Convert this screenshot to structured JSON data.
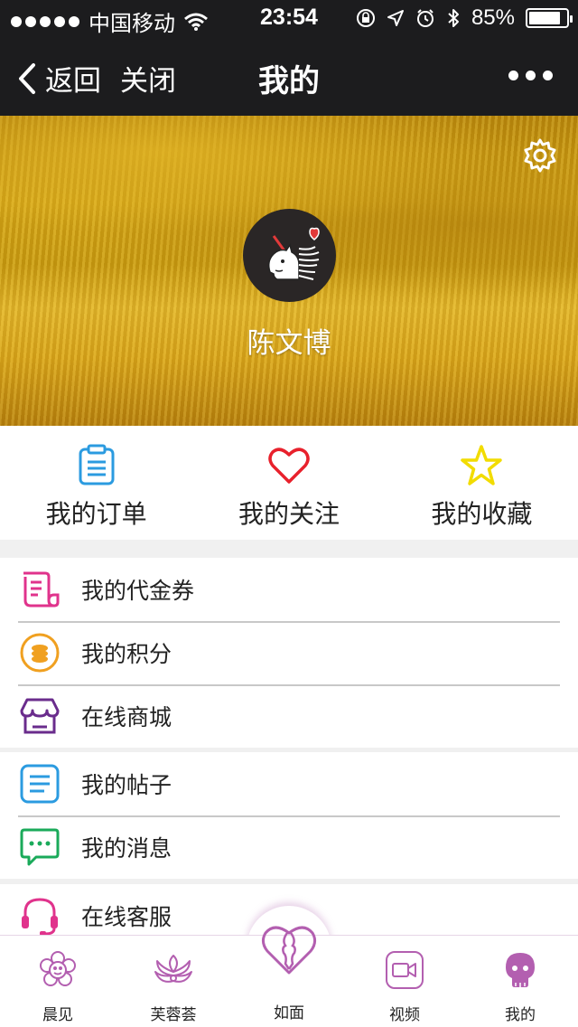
{
  "status_bar": {
    "carrier": "中国移动",
    "time": "23:54",
    "battery": "85%",
    "battery_level": 0.85
  },
  "nav": {
    "back_label": "返回",
    "close_label": "关闭",
    "title": "我的"
  },
  "profile": {
    "name": "陈文博"
  },
  "quick_actions": [
    {
      "label": "我的订单",
      "icon": "clipboard-icon",
      "color": "#2b9be0"
    },
    {
      "label": "我的关注",
      "icon": "heart-icon",
      "color": "#e8212c"
    },
    {
      "label": "我的收藏",
      "icon": "star-icon",
      "color": "#f2dc00"
    }
  ],
  "menu_group_1": [
    {
      "label": "我的代金券",
      "icon": "voucher-icon"
    },
    {
      "label": "我的积分",
      "icon": "coins-icon"
    },
    {
      "label": "在线商城",
      "icon": "shop-icon"
    }
  ],
  "menu_group_2": [
    {
      "label": "我的帖子",
      "icon": "posts-icon"
    },
    {
      "label": "我的消息",
      "icon": "message-icon"
    }
  ],
  "menu_group_3": [
    {
      "label": "在线客服",
      "icon": "headset-icon"
    }
  ],
  "tab_bar": [
    {
      "label": "晨见",
      "icon": "flower-icon"
    },
    {
      "label": "芙蓉荟",
      "icon": "lotus-icon"
    },
    {
      "label": "如面",
      "icon": "face-heart-icon"
    },
    {
      "label": "视频",
      "icon": "video-icon"
    },
    {
      "label": "我的",
      "icon": "user-icon"
    }
  ],
  "colors": {
    "nav_background": "#1c1c1e",
    "tab_accent": "#b35fb0",
    "divider": "#c8c8c8"
  }
}
